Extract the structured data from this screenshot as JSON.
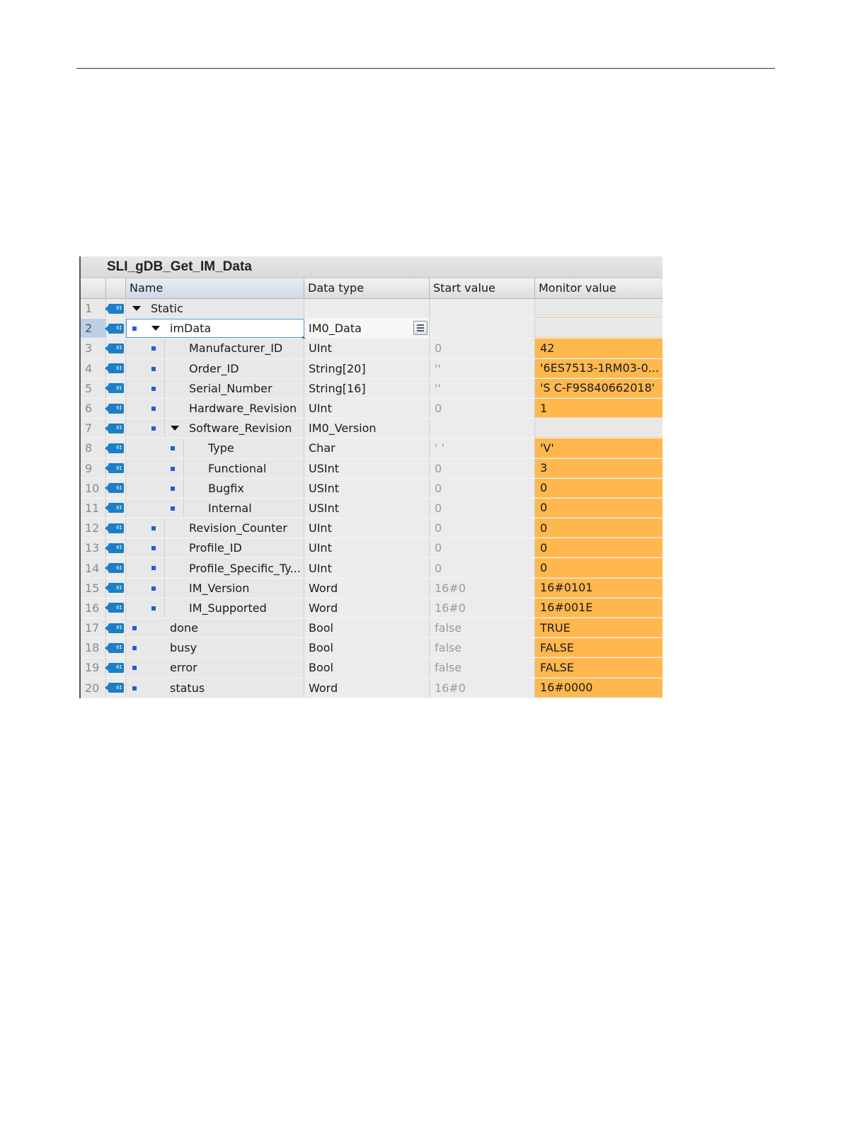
{
  "table": {
    "title": "SLI_gDB_Get_IM_Data",
    "columns": {
      "name": "Name",
      "data_type": "Data type",
      "start_value": "Start value",
      "monitor_value": "Monitor value"
    },
    "interface_icon_label": "0I",
    "rows": [
      {
        "num": "1",
        "name": "Static",
        "level": 0,
        "expander": true,
        "bullet": false,
        "data_type": "",
        "start": "",
        "monitor": ""
      },
      {
        "num": "2",
        "name": "imData",
        "level": 1,
        "expander": true,
        "bullet": true,
        "data_type": "IM0_Data",
        "start": "",
        "monitor": "",
        "selected": true
      },
      {
        "num": "3",
        "name": "Manufacturer_ID",
        "level": 2,
        "expander": false,
        "bullet": true,
        "data_type": "UInt",
        "start": "0",
        "monitor": "42"
      },
      {
        "num": "4",
        "name": "Order_ID",
        "level": 2,
        "expander": false,
        "bullet": true,
        "data_type": "String[20]",
        "start": "''",
        "monitor": "'6ES7513-1RM03-0..."
      },
      {
        "num": "5",
        "name": "Serial_Number",
        "level": 2,
        "expander": false,
        "bullet": true,
        "data_type": "String[16]",
        "start": "''",
        "monitor": "'S C-F9S840662018'"
      },
      {
        "num": "6",
        "name": "Hardware_Revision",
        "level": 2,
        "expander": false,
        "bullet": true,
        "data_type": "UInt",
        "start": "0",
        "monitor": "1"
      },
      {
        "num": "7",
        "name": "Software_Revision",
        "level": 2,
        "expander": true,
        "bullet": true,
        "data_type": "IM0_Version",
        "start": "",
        "monitor": ""
      },
      {
        "num": "8",
        "name": "Type",
        "level": 3,
        "expander": false,
        "bullet": true,
        "data_type": "Char",
        "start": "' '",
        "monitor": "'V'"
      },
      {
        "num": "9",
        "name": "Functional",
        "level": 3,
        "expander": false,
        "bullet": true,
        "data_type": "USInt",
        "start": "0",
        "monitor": "3"
      },
      {
        "num": "10",
        "name": "Bugfix",
        "level": 3,
        "expander": false,
        "bullet": true,
        "data_type": "USInt",
        "start": "0",
        "monitor": "0"
      },
      {
        "num": "11",
        "name": "Internal",
        "level": 3,
        "expander": false,
        "bullet": true,
        "data_type": "USInt",
        "start": "0",
        "monitor": "0"
      },
      {
        "num": "12",
        "name": "Revision_Counter",
        "level": 2,
        "expander": false,
        "bullet": true,
        "data_type": "UInt",
        "start": "0",
        "monitor": "0"
      },
      {
        "num": "13",
        "name": "Profile_ID",
        "level": 2,
        "expander": false,
        "bullet": true,
        "data_type": "UInt",
        "start": "0",
        "monitor": "0"
      },
      {
        "num": "14",
        "name": "Profile_Specific_Ty...",
        "level": 2,
        "expander": false,
        "bullet": true,
        "data_type": "UInt",
        "start": "0",
        "monitor": "0"
      },
      {
        "num": "15",
        "name": "IM_Version",
        "level": 2,
        "expander": false,
        "bullet": true,
        "data_type": "Word",
        "start": "16#0",
        "monitor": "16#0101"
      },
      {
        "num": "16",
        "name": "IM_Supported",
        "level": 2,
        "expander": false,
        "bullet": true,
        "data_type": "Word",
        "start": "16#0",
        "monitor": "16#001E"
      },
      {
        "num": "17",
        "name": "done",
        "level": 1,
        "expander": false,
        "bullet": true,
        "data_type": "Bool",
        "start": "false",
        "monitor": "TRUE"
      },
      {
        "num": "18",
        "name": "busy",
        "level": 1,
        "expander": false,
        "bullet": true,
        "data_type": "Bool",
        "start": "false",
        "monitor": "FALSE"
      },
      {
        "num": "19",
        "name": "error",
        "level": 1,
        "expander": false,
        "bullet": true,
        "data_type": "Bool",
        "start": "false",
        "monitor": "FALSE"
      },
      {
        "num": "20",
        "name": "status",
        "level": 1,
        "expander": false,
        "bullet": true,
        "data_type": "Word",
        "start": "16#0",
        "monitor": "16#0000"
      }
    ]
  }
}
